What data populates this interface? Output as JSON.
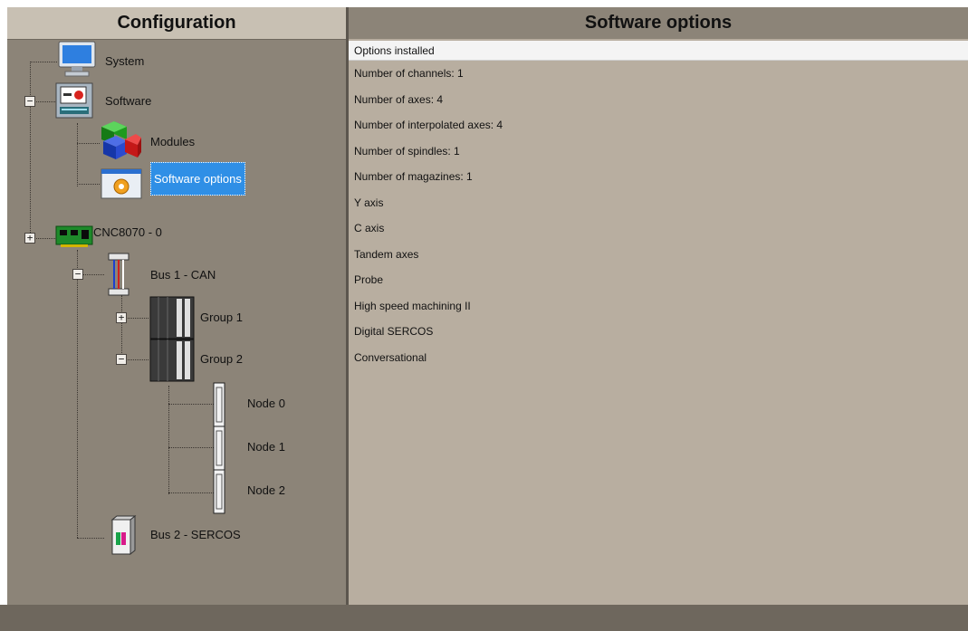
{
  "left_panel": {
    "title": "Configuration"
  },
  "right_panel": {
    "title": "Software options",
    "subheader": "Options installed"
  },
  "tree": {
    "system": "System",
    "software": "Software",
    "modules": "Modules",
    "software_options": "Software options",
    "cnc": "CNC8070 - 0",
    "bus1": "Bus 1 - CAN",
    "group1": "Group 1",
    "group2": "Group 2",
    "node0": "Node 0",
    "node1": "Node 1",
    "node2": "Node 2",
    "bus2": "Bus 2 - SERCOS"
  },
  "options": [
    "Number of channels: 1",
    "Number of axes: 4",
    "Number of interpolated axes: 4",
    "Number of spindles: 1",
    "Number of magazines: 1",
    "Y axis",
    "C axis",
    "Tandem axes",
    "Probe",
    "High speed machining II",
    "Digital SERCOS",
    "Conversational"
  ],
  "colors": {
    "selected": "#2f8fe6",
    "panel_bg": "#8c8478",
    "content_bg": "#b8aea0"
  }
}
